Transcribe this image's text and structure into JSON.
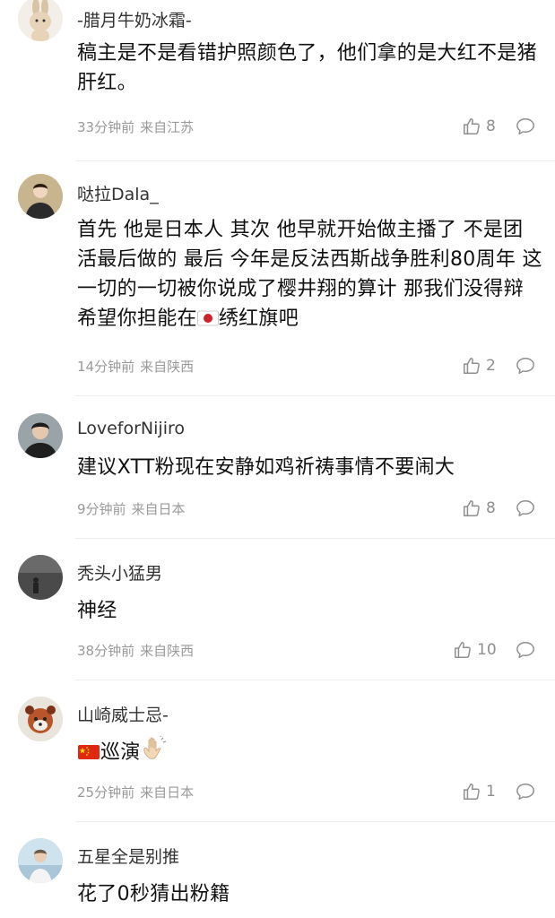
{
  "comments": [
    {
      "username": "-腊月牛奶冰霜-",
      "body": "稿主是不是看错护照颜色了，他们拿的是大红不是猪肝红。",
      "time": "33分钟前",
      "location": "来自江苏",
      "likes": "8",
      "avatar_icon": "rabbit-avatar-icon"
    },
    {
      "username": "哒拉Dala_",
      "body_parts": [
        "首先 他是日本人 其次 他早就开始做主播了 不是团活最后做的 最后 今年是反法西斯战争胜利80周年 这一切的一切被你说成了樱井翔的算计 那我们没得辩 希望你担能在",
        "绣红旗吧"
      ],
      "emoji": "japan-flag-icon",
      "time": "14分钟前",
      "location": "来自陕西",
      "likes": "2",
      "avatar_icon": "person-avatar-icon"
    },
    {
      "username": "LoveforNijiro",
      "body": "建议XTT粉现在安静如鸡祈祷事情不要闹大",
      "time": "9分钟前",
      "location": "来自日本",
      "likes": "8",
      "avatar_icon": "person-avatar-icon"
    },
    {
      "username": "秃头小猛男",
      "body": "神经",
      "time": "38分钟前",
      "location": "来自陕西",
      "likes": "10",
      "avatar_icon": "figure-avatar-icon"
    },
    {
      "username": "山崎威士忌-",
      "body": "巡演",
      "emoji_before": "china-flag-icon",
      "emoji_after": "waving-hand-icon",
      "time": "25分钟前",
      "location": "来自日本",
      "likes": "1",
      "avatar_icon": "red-panda-avatar-icon"
    },
    {
      "username": "五星全是别推",
      "body": "花了0秒猜出粉籍",
      "avatar_icon": "person-avatar-icon"
    }
  ],
  "colors": {
    "text": "#111111",
    "meta": "#9a9a9a",
    "divider": "#ededed"
  }
}
